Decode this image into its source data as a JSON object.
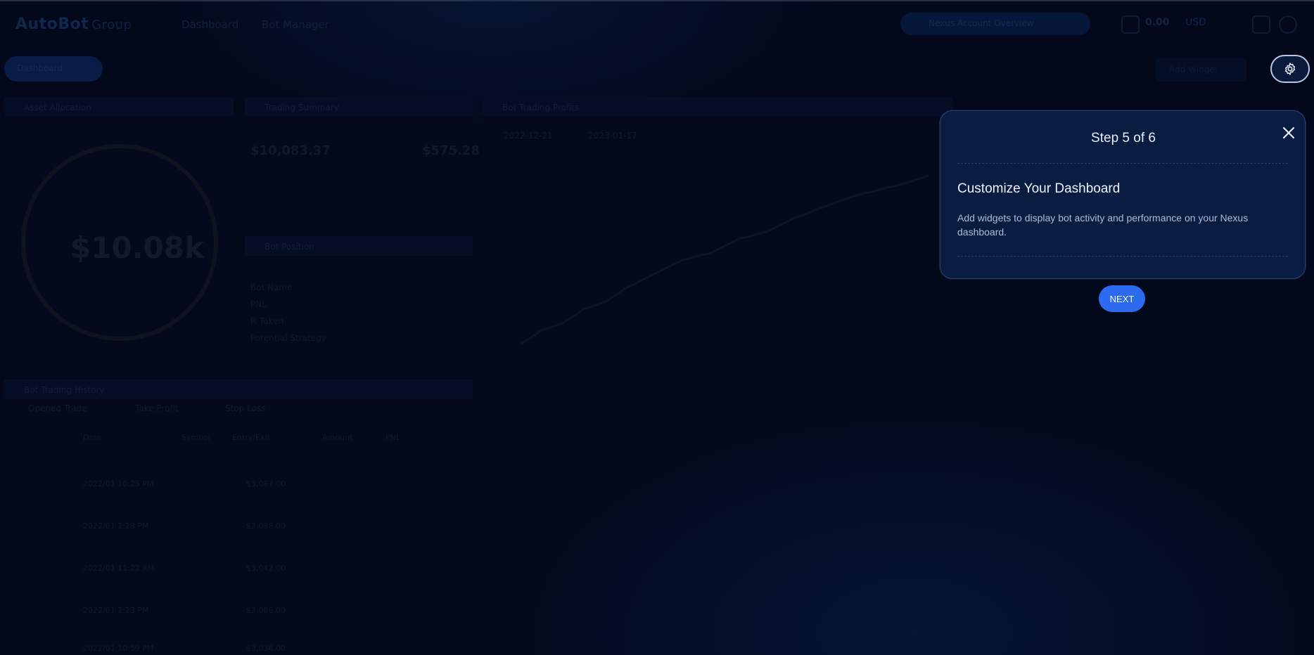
{
  "app": {
    "logo": "AutoBot",
    "logo_sub": "Group",
    "nav": [
      "Dashboard",
      "Bot Manager"
    ],
    "account_pill": "Nexus Account Overview",
    "balance": "0.00",
    "balance_currency": "USD"
  },
  "toolbar": {
    "filter_badge": "Dashboard",
    "add_widget": "Add Widget",
    "settings_icon": "gear-icon"
  },
  "widgets": {
    "asset_allocation": {
      "title": "Asset Allocation",
      "total": "$10.08k"
    },
    "trading_summary": {
      "title": "Trading Summary",
      "val1": "$10,083.37",
      "val2": "$575.28"
    },
    "bot_position": {
      "title": "Bot Position",
      "rows": [
        "Bot Name",
        "PNL",
        "P. Taken",
        "Potential Strategy"
      ]
    },
    "trading_profits": {
      "title": "Bot Trading Profits",
      "range1": "2022-12-21",
      "range2": "2023-01-17"
    },
    "trading_history": {
      "title": "Bot Trading History",
      "tabs": [
        "Opened Trade",
        "Take Profit",
        "Stop Loss"
      ],
      "columns": [
        "Date",
        "Symbol",
        "Entry/Exit",
        "Amount",
        "PNL"
      ],
      "rows": [
        {
          "date": "2022/01 10:25 PM",
          "entry": "$3,087.00"
        },
        {
          "date": "2022/01 2:28 PM",
          "entry": "$3,088.00"
        },
        {
          "date": "2022/01 11:22 AM",
          "entry": "$3,042.00"
        },
        {
          "date": "2022/01 2:23 PM",
          "entry": "$3,066.00"
        },
        {
          "date": "2022/01 10:59 PM",
          "entry": "$3,036.00"
        }
      ]
    }
  },
  "tour": {
    "step": "Step 5 of 6",
    "title": "Customize Your Dashboard",
    "body": "Add widgets to display bot activity and performance on your Nexus dashboard.",
    "next_label": "NEXT",
    "close_icon": "close-icon"
  },
  "colors": {
    "accent": "#2c6bf0",
    "popover_bg": "#0b1c42",
    "page_bg": "#050d22"
  }
}
